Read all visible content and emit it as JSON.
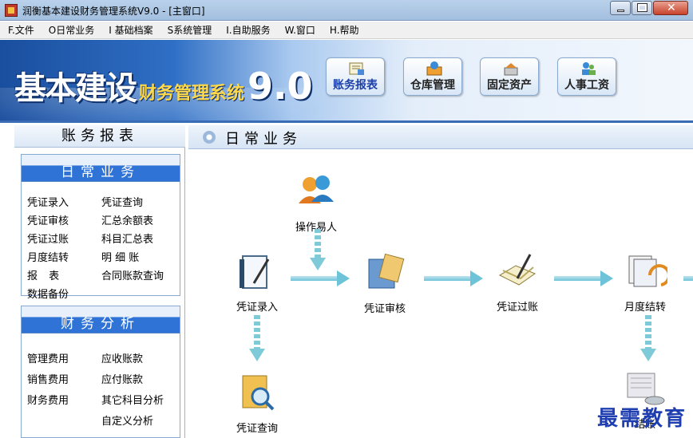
{
  "window": {
    "title": "润衡基本建设财务管理系统V9.0 - [主窗口]"
  },
  "menubar": [
    "F.文件",
    "O日常业务",
    "I 基础档案",
    "S系统管理",
    "I.自助服务",
    "W.窗口",
    "H.帮助"
  ],
  "banner": {
    "logo_main": "基本建设",
    "logo_sub": "财务管理系统",
    "logo_version": "9.0",
    "buttons": [
      {
        "label": "账务报表",
        "icon": "ledger-report-icon"
      },
      {
        "label": "仓库管理",
        "icon": "warehouse-icon"
      },
      {
        "label": "固定资产",
        "icon": "fixed-assets-icon"
      },
      {
        "label": "人事工资",
        "icon": "payroll-icon"
      }
    ]
  },
  "leftpanel": {
    "header": "账务报表",
    "sections": [
      {
        "title": "日常业务",
        "items": [
          "凭证录入",
          "凭证查询",
          "凭证审核",
          "汇总余额表",
          "凭证过账",
          "科目汇总表",
          "月度结转",
          "明 细 账",
          "报 表",
          "合同账款查询",
          "数据备份"
        ]
      },
      {
        "title": "财务分析",
        "items": [
          "管理费用",
          "应收账款",
          "销售费用",
          "应付账款",
          "财务费用",
          "其它科目分析",
          "自定义分析"
        ]
      }
    ]
  },
  "main": {
    "title": "日常业务",
    "nodes": [
      {
        "label": "操作易人",
        "icon": "operator-users-icon"
      },
      {
        "label": "凭证录入",
        "icon": "voucher-entry-icon"
      },
      {
        "label": "凭证审核",
        "icon": "voucher-audit-icon"
      },
      {
        "label": "凭证过账",
        "icon": "voucher-posting-icon"
      },
      {
        "label": "月度结转",
        "icon": "monthly-closing-icon"
      },
      {
        "label": "凭证查询",
        "icon": "voucher-query-icon"
      },
      {
        "label": "结账",
        "icon": "closing-books-icon"
      }
    ]
  },
  "watermark": "最需教育",
  "colors": {
    "accent_blue": "#2f73d6",
    "banner_dark": "#1a4e9e",
    "arrow_teal": "#6fc3d8",
    "watermark": "#1f3fb0"
  }
}
